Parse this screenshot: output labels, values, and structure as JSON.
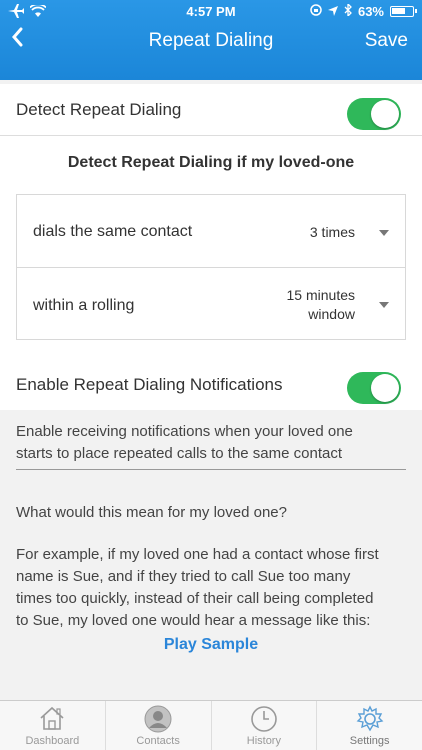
{
  "status_bar": {
    "time": "4:57 PM",
    "battery": "63%",
    "left_icons": [
      "airplane-icon",
      "wifi-icon"
    ],
    "right_icons": [
      "lock-rotation-icon",
      "location-icon",
      "bluetooth-icon",
      "battery-icon"
    ]
  },
  "nav": {
    "back_icon": "chevron-left-icon",
    "title": "Repeat Dialing",
    "save_label": "Save"
  },
  "detect_row": {
    "label": "Detect Repeat Dialing",
    "toggle_on": true
  },
  "criteria": {
    "title": "Detect Repeat Dialing if my loved-one",
    "rows": [
      {
        "label": "dials the same contact",
        "value": "3 times"
      },
      {
        "label": "within a rolling",
        "value_line1": "15 minutes",
        "value_line2": "window"
      }
    ]
  },
  "notifications_row": {
    "label": "Enable Repeat Dialing Notifications",
    "toggle_on": true
  },
  "notifications_description": {
    "line1": "Enable receiving notifications when your loved one",
    "line2": "starts to place repeated calls to the same contact"
  },
  "explanation": {
    "question": "What would this mean for my loved one?",
    "line1": "For example, if my loved one had a contact whose first",
    "line2": "name is Sue, and if they tried to call Sue too many",
    "line3": "times too quickly, instead of their call being completed",
    "line4": "to Sue, my loved one would hear a message like this:",
    "play_label": "Play Sample"
  },
  "colors": {
    "header": "#1b86d8",
    "toggle_on": "#2fb85a",
    "link": "#2b86d9"
  },
  "tabbar": {
    "tabs": [
      {
        "label": "Dashboard",
        "icon": "home-icon"
      },
      {
        "label": "Contacts",
        "icon": "person-icon"
      },
      {
        "label": "History",
        "icon": "clock-icon"
      },
      {
        "label": "Settings",
        "icon": "gear-icon"
      }
    ]
  }
}
